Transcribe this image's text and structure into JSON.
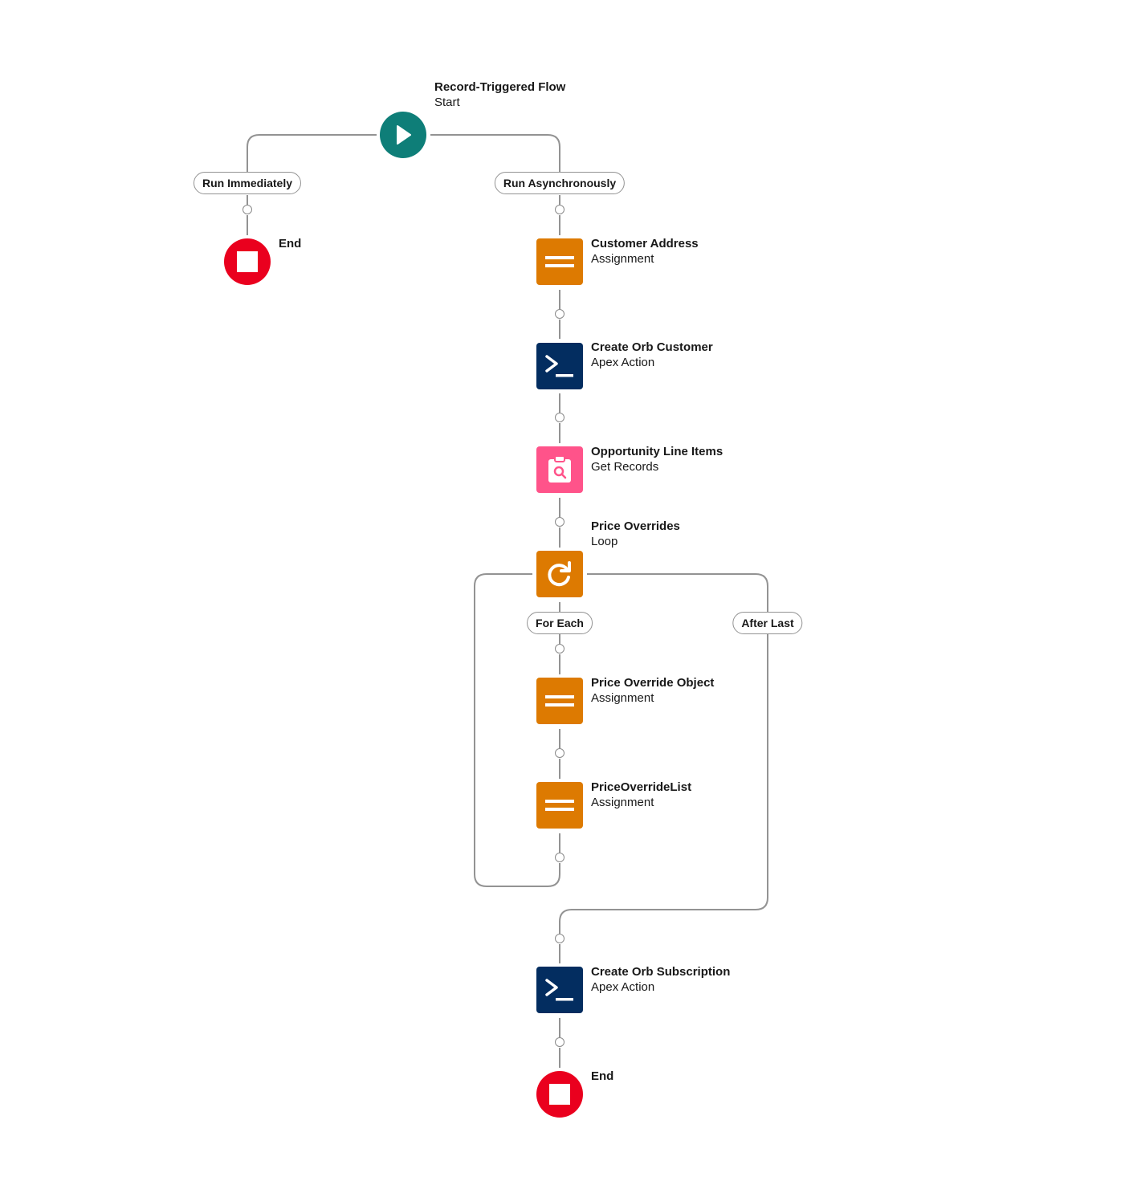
{
  "colors": {
    "start": "#0e7e78",
    "end": "#ea001e",
    "assignment": "#dd7a01",
    "apex_action": "#032d60",
    "get_records": "#ff538a",
    "loop": "#dd7a01",
    "connector_line": "#939393"
  },
  "start": {
    "title": "Record-Triggered Flow",
    "type": "Start",
    "icon": "play-icon"
  },
  "branches": {
    "run_immediately": "Run Immediately",
    "run_asynchronously": "Run Asynchronously"
  },
  "end_left": {
    "title": "End",
    "icon": "stop-icon"
  },
  "elements": [
    {
      "title": "Customer Address",
      "type": "Assignment",
      "icon": "equals-icon"
    },
    {
      "title": "Create Orb Customer",
      "type": "Apex Action",
      "icon": "terminal-icon"
    },
    {
      "title": "Opportunity Line Items",
      "type": "Get Records",
      "icon": "clipboard-search-icon"
    },
    {
      "title": "Price Overrides",
      "type": "Loop",
      "icon": "loop-icon"
    },
    {
      "title": "Price Override Object",
      "type": "Assignment",
      "icon": "equals-icon"
    },
    {
      "title": "PriceOverrideList",
      "type": "Assignment",
      "icon": "equals-icon"
    },
    {
      "title": "Create Orb Subscription",
      "type": "Apex Action",
      "icon": "terminal-icon"
    }
  ],
  "loop_paths": {
    "for_each": "For Each",
    "after_last": "After Last"
  },
  "end_right": {
    "title": "End",
    "icon": "stop-icon"
  }
}
